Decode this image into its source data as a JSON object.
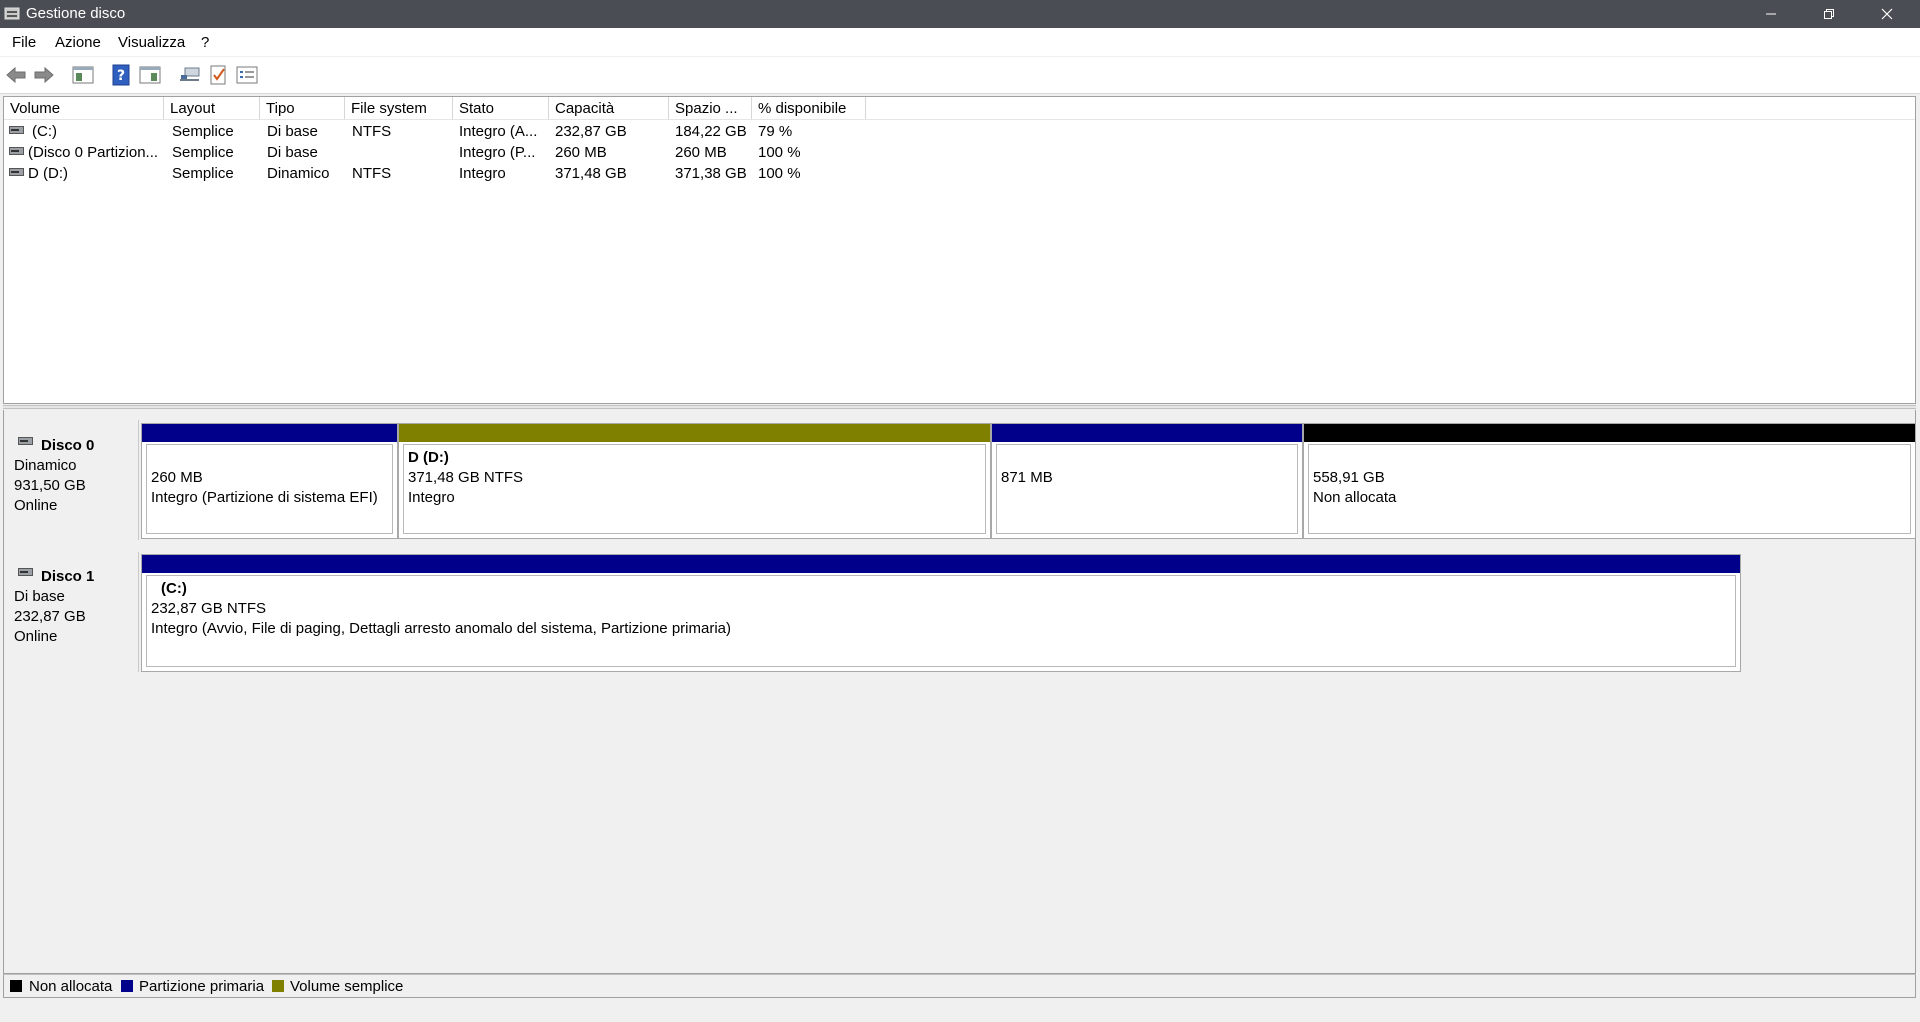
{
  "window": {
    "title": "Gestione disco"
  },
  "menu": [
    "File",
    "Azione",
    "Visualizza",
    "?"
  ],
  "toolbar": [
    "back-icon",
    "forward-icon",
    "console-tree-icon",
    "help-icon",
    "properties-icon",
    "connect-icon",
    "check-icon",
    "list-view-icon"
  ],
  "volume_list": {
    "columns": [
      "Volume",
      "Layout",
      "Tipo",
      "File system",
      "Stato",
      "Capacità",
      "Spazio ...",
      "% disponibile"
    ],
    "rows": [
      [
        "(C:)",
        "Semplice",
        "Di base",
        "NTFS",
        "Integro (A...",
        "232,87 GB",
        "184,22 GB",
        "79 %"
      ],
      [
        "(Disco 0 Partizion...",
        "Semplice",
        "Di base",
        "",
        "Integro (P...",
        "260 MB",
        "260 MB",
        "100 %"
      ],
      [
        "D (D:)",
        "Semplice",
        "Dinamico",
        "NTFS",
        "Integro",
        "371,48 GB",
        "371,38 GB",
        "100 %"
      ]
    ]
  },
  "disks": [
    {
      "name": "Disco 0",
      "type": "Dinamico",
      "size": "931,50 GB",
      "status": "Online",
      "partitions": [
        {
          "title": "",
          "line1": "260 MB",
          "line2": "Integro (Partizione di sistema EFI)"
        },
        {
          "title": "D  (D:)",
          "line1": "371,48 GB NTFS",
          "line2": "Integro"
        },
        {
          "title": "",
          "line1": "871 MB",
          "line2": ""
        },
        {
          "title": "",
          "line1": "558,91 GB",
          "line2": "Non allocata"
        }
      ]
    },
    {
      "name": "Disco 1",
      "type": "Di base",
      "size": "232,87 GB",
      "status": "Online",
      "partitions": [
        {
          "title": "(C:)",
          "line1": "232,87 GB NTFS",
          "line2": "Integro (Avvio, File di paging, Dettagli arresto anomalo del sistema, Partizione primaria)"
        }
      ]
    }
  ],
  "legend": [
    {
      "label": "Non allocata",
      "color": "#000000"
    },
    {
      "label": "Partizione primaria",
      "color": "#00008b"
    },
    {
      "label": "Volume semplice",
      "color": "#808000"
    }
  ],
  "colors": {
    "unallocated": "#000000",
    "primary": "#00008b",
    "simple": "#808000",
    "titlebar": "#4a4d53"
  }
}
